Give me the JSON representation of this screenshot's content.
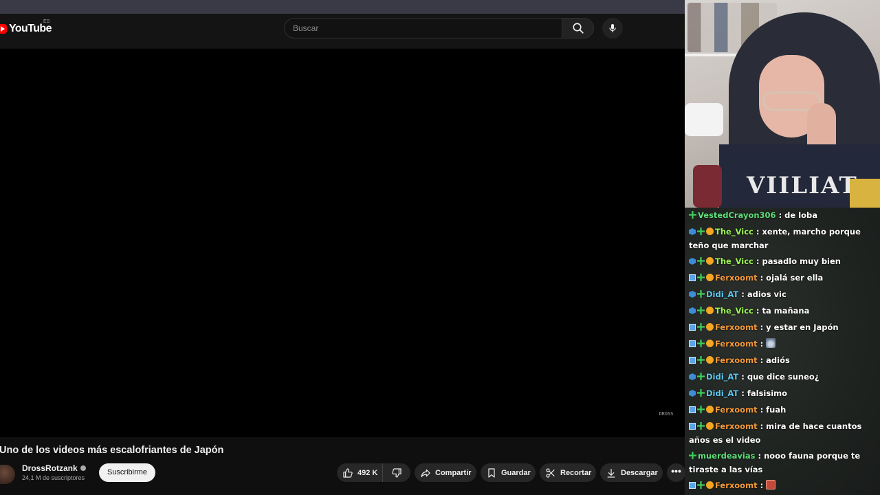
{
  "youtube": {
    "logo_text": "YouTube",
    "country_code": "ES",
    "search_placeholder": "Buscar",
    "video_title": "Uno de los videos más escalofriantes de Japón",
    "channel_name": "DrossRotzank",
    "subscribers": "24,1 M de suscriptores",
    "subscribe_label": "Suscribirme",
    "like_count": "492 K",
    "share_label": "Compartir",
    "save_label": "Guardar",
    "clip_label": "Recortar",
    "download_label": "Descargar",
    "more_label": "•••",
    "watermark": "DROSS"
  },
  "chat": {
    "messages": [
      {
        "user": "VestedCrayon306",
        "color": "#5fe07a",
        "badges": [
          "green"
        ],
        "text": "de loba"
      },
      {
        "user": "The_Vicc",
        "color": "#9cf553",
        "badges": [
          "blue",
          "green",
          "orange"
        ],
        "text": "xente, marcho porque teño que marchar"
      },
      {
        "user": "The_Vicc",
        "color": "#9cf553",
        "badges": [
          "blue",
          "green",
          "orange"
        ],
        "text": "pasadlo muy bien"
      },
      {
        "user": "Ferxoomt",
        "color": "#f59b3c",
        "badges": [
          "x",
          "green",
          "orange"
        ],
        "text": "ojalá ser ella"
      },
      {
        "user": "Didi_AT",
        "color": "#5ec8f0",
        "badges": [
          "blue",
          "green"
        ],
        "text": "adios vic"
      },
      {
        "user": "The_Vicc",
        "color": "#9cf553",
        "badges": [
          "blue",
          "green",
          "orange"
        ],
        "text": "ta mañana"
      },
      {
        "user": "Ferxoomt",
        "color": "#f59b3c",
        "badges": [
          "x",
          "green",
          "orange"
        ],
        "text": "y estar en Japón"
      },
      {
        "user": "Ferxoomt",
        "color": "#f59b3c",
        "badges": [
          "x",
          "green",
          "orange"
        ],
        "text": "",
        "emote": "bunny"
      },
      {
        "user": "Ferxoomt",
        "color": "#f59b3c",
        "badges": [
          "x",
          "green",
          "orange"
        ],
        "text": "adiós"
      },
      {
        "user": "Didi_AT",
        "color": "#5ec8f0",
        "badges": [
          "blue",
          "green"
        ],
        "text": "que dice suneo¿"
      },
      {
        "user": "Didi_AT",
        "color": "#5ec8f0",
        "badges": [
          "blue",
          "green"
        ],
        "text": "falsisimo"
      },
      {
        "user": "Ferxoomt",
        "color": "#f59b3c",
        "badges": [
          "x",
          "green",
          "orange"
        ],
        "text": "fuah"
      },
      {
        "user": "Ferxoomt",
        "color": "#f59b3c",
        "badges": [
          "x",
          "green",
          "orange"
        ],
        "text": "mira de hace cuantos años es el video"
      },
      {
        "user": "muerdeavias",
        "color": "#5fe07a",
        "badges": [
          "green"
        ],
        "text": "nooo fauna porque te tiraste a las vías"
      },
      {
        "user": "Ferxoomt",
        "color": "#f59b3c",
        "badges": [
          "x",
          "green",
          "orange"
        ],
        "text": "",
        "emote": "box"
      },
      {
        "user": "Ferxoomt",
        "color": "#f59b3c",
        "badges": [
          "x",
          "green",
          "orange"
        ],
        "text": "",
        "emote": "box"
      }
    ]
  },
  "webcam": {
    "shirt_text": "VIILIAT"
  }
}
